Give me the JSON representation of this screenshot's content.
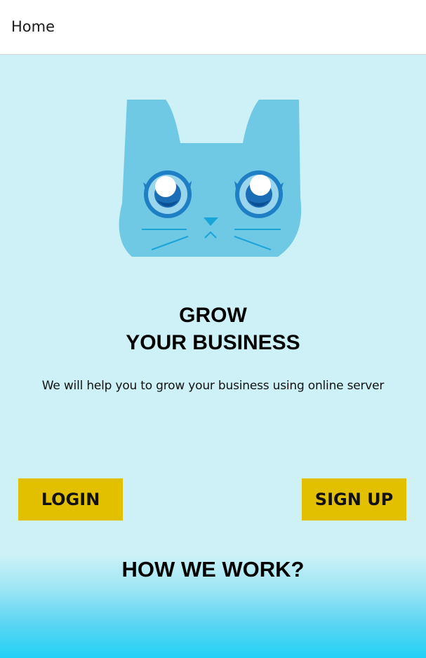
{
  "header": {
    "title": "Home"
  },
  "hero": {
    "headline_line1": "GROW",
    "headline_line2": "YOUR BUSINESS",
    "subtext": "We will help you to grow your business using online server"
  },
  "buttons": {
    "login": "LOGIN",
    "signup": "SIGN UP"
  },
  "section": {
    "how_we_work": "HOW WE WORK?"
  },
  "colors": {
    "background": "#cdf1f6",
    "button": "#e2c000",
    "gradient_bottom": "#22d1f6",
    "cat_face": "#6fc8e4",
    "cat_eye": "#1f7fc5"
  },
  "icons": {
    "logo": "cat-face-icon"
  }
}
